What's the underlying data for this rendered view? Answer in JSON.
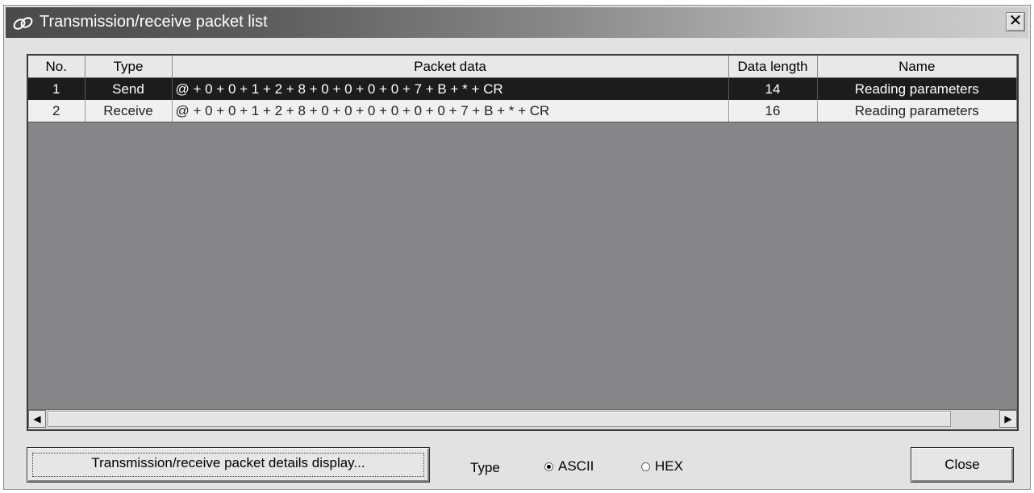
{
  "window": {
    "title": "Transmission/receive packet list",
    "close_symbol": "✕"
  },
  "table": {
    "columns": [
      "No.",
      "Type",
      "Packet data",
      "Data length",
      "Name"
    ],
    "rows": [
      {
        "no": "1",
        "type": "Send",
        "packet": "@ + 0 + 0 + 1 + 2 + 8 + 0 + 0 + 0 + 0 + 7 + B + * + CR",
        "length": "14",
        "name": "Reading parameters",
        "selected": true
      },
      {
        "no": "2",
        "type": "Receive",
        "packet": "@ + 0 + 0 + 1 + 2 + 8 + 0 + 0 + 0 + 0 + 0 + 0 + 7 + B + * + CR",
        "length": "16",
        "name": "Reading parameters",
        "selected": false
      }
    ]
  },
  "scroll": {
    "left": "◀",
    "right": "▶"
  },
  "controls": {
    "details_button": "Transmission/receive packet details display...",
    "type_label": "Type",
    "radio_ascii": "ASCII",
    "radio_hex": "HEX",
    "selected_type": "ASCII",
    "close_button": "Close"
  }
}
